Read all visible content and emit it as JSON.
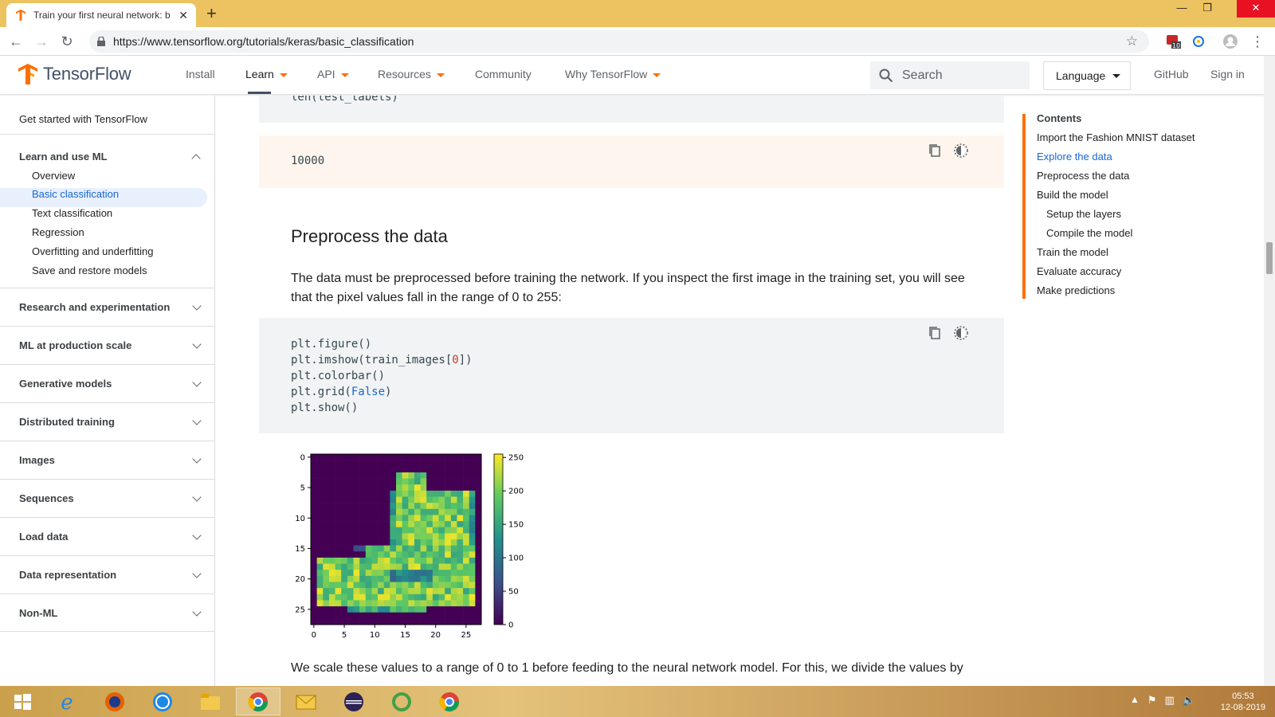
{
  "browser": {
    "tab_title": "Train your first neural network: b",
    "url": "https://www.tensorflow.org/tutorials/keras/basic_classification",
    "extension_badge": "10"
  },
  "header": {
    "brand": "TensorFlow",
    "nav": [
      "Install",
      "Learn",
      "API",
      "Resources",
      "Community",
      "Why TensorFlow"
    ],
    "search_placeholder": "Search",
    "language": "Language",
    "github": "GitHub",
    "signin": "Sign in"
  },
  "leftnav": {
    "get_started": "Get started with TensorFlow",
    "section_open": "Learn and use ML",
    "items": [
      "Overview",
      "Basic classification",
      "Text classification",
      "Regression",
      "Overfitting and underfitting",
      "Save and restore models"
    ],
    "sections": [
      "Research and experimentation",
      "ML at production scale",
      "Generative models",
      "Distributed training",
      "Images",
      "Sequences",
      "Load data",
      "Data representation",
      "Non-ML"
    ]
  },
  "content": {
    "prev_code": "len(test_labels)",
    "output_value": "10000",
    "heading": "Preprocess the data",
    "paragraph": "The data must be preprocessed before training the network. If you inspect the first image in the training set, you will see that the pixel values fall in the range of 0 to 255:",
    "code": {
      "line1": "plt.figure()",
      "line2a": "plt.imshow(train_images[",
      "line2num": "0",
      "line2b": "])",
      "line3": "plt.colorbar()",
      "line4a": "plt.grid(",
      "line4kw": "False",
      "line4b": ")",
      "line5": "plt.show()"
    },
    "paragraph2": "We scale these values to a range of 0 to 1 before feeding to the neural network model. For this, we divide the values by"
  },
  "chart_data": {
    "type": "heatmap",
    "description_of_content": "28x28 grayscale-intensity image of an ankle boot (viridis colormap)",
    "x_ticks": [
      "0",
      "5",
      "10",
      "15",
      "20",
      "25"
    ],
    "y_ticks": [
      "0",
      "5",
      "10",
      "15",
      "20",
      "25"
    ],
    "colorbar_ticks": [
      "0",
      "50",
      "100",
      "150",
      "200",
      "250"
    ],
    "value_range": [
      0,
      255
    ],
    "colormap": "viridis"
  },
  "toc": {
    "title": "Contents",
    "items": [
      "Import the Fashion MNIST dataset",
      "Explore the data",
      "Preprocess the data",
      "Build the model",
      "Setup the layers",
      "Compile the model",
      "Train the model",
      "Evaluate accuracy",
      "Make predictions"
    ]
  },
  "taskbar": {
    "time": "05:53",
    "date": "12-08-2019"
  },
  "colors": {
    "accent": "#ff6f00",
    "link_active": "#1967d2",
    "tab_strip": "#ecc360"
  }
}
